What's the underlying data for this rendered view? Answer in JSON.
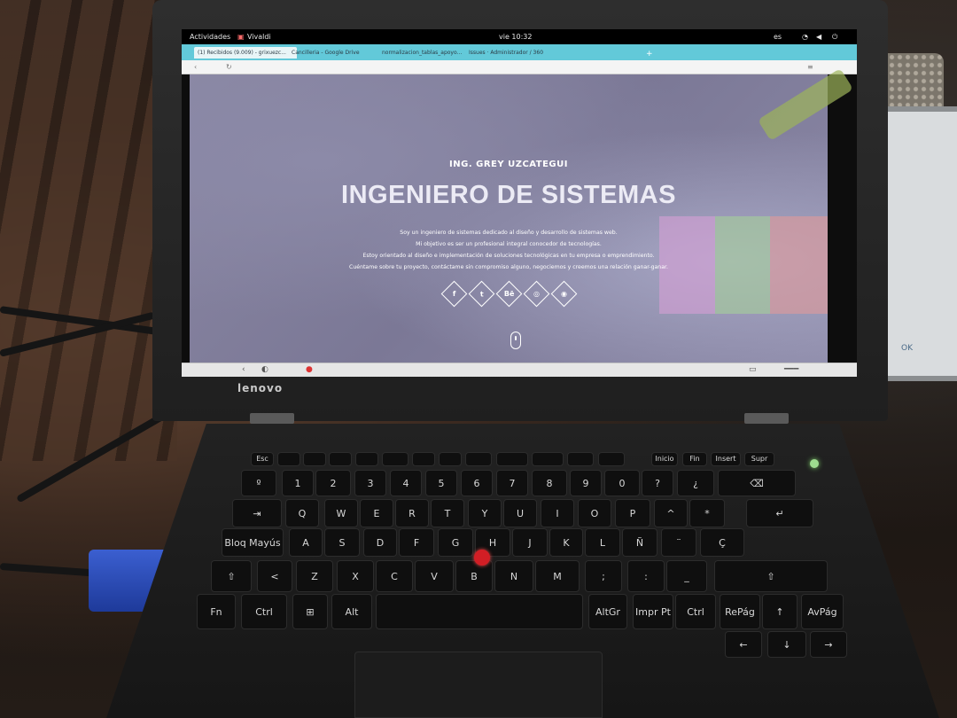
{
  "desktop": {
    "activities_label": "Actividades",
    "app_name": "Vivaldi",
    "clock": "vie 10:32",
    "keyboard_layout": "es"
  },
  "browser": {
    "tabs": [
      {
        "label": "(1) Recibidos (9.009) - grixuezc..."
      },
      {
        "label": "Cancilleria - Google Drive"
      },
      {
        "label": "normalizacion_tablas_apoyo..."
      },
      {
        "label": "Issues · Administrador / 360"
      }
    ]
  },
  "page": {
    "subtitle": "ING. GREY UZCATEGUI",
    "title": "INGENIERO DE SISTEMAS",
    "bio_lines": [
      "Soy un ingeniero de sistemas dedicado al diseño y desarrollo de sistemas web.",
      "Mi objetivo es ser un profesional integral conocedor de tecnologías.",
      "Estoy orientado al diseño e implementación de soluciones tecnológicas en tu empresa o emprendimiento.",
      "Cuéntame sobre tu proyecto, contáctame sin compromiso alguno, negociemos y creemos una relación ganar-ganar."
    ],
    "socials": [
      {
        "icon": "facebook-icon",
        "glyph": "f"
      },
      {
        "icon": "twitter-icon",
        "glyph": "t"
      },
      {
        "icon": "behance-icon",
        "glyph": "Bē"
      },
      {
        "icon": "instagram-icon",
        "glyph": "◎"
      },
      {
        "icon": "dribbble-icon",
        "glyph": "◉"
      }
    ]
  },
  "laptop": {
    "brand": "lenovo",
    "side_monitor_text": "OK"
  },
  "keyboard": {
    "rows": [
      [
        "Esc",
        "",
        "",
        "",
        "",
        "",
        "",
        "",
        "",
        "",
        "",
        "",
        "",
        "Inicio",
        "Fin",
        "Insert",
        "Supr"
      ],
      [
        "º",
        "1",
        "2",
        "3",
        "4",
        "5",
        "6",
        "7",
        "8",
        "9",
        "0",
        "?",
        "¿",
        "⌫"
      ],
      [
        "⇥",
        "Q",
        "W",
        "E",
        "R",
        "T",
        "Y",
        "U",
        "I",
        "O",
        "P",
        "^",
        "*",
        "↵"
      ],
      [
        "Bloq Mayús",
        "A",
        "S",
        "D",
        "F",
        "G",
        "H",
        "J",
        "K",
        "L",
        "Ñ",
        "¨",
        "Ç"
      ],
      [
        "⇧",
        "<",
        "Z",
        "X",
        "C",
        "V",
        "B",
        "N",
        "M",
        ";",
        ":",
        "_",
        "⇧"
      ],
      [
        "Fn",
        "Ctrl",
        "⊞",
        "Alt",
        "",
        "AltGr",
        "Impr Pt",
        "Ctrl",
        "RePág",
        "↑",
        "AvPág"
      ],
      [
        "←",
        "↓",
        "→"
      ]
    ]
  },
  "colors": {
    "vivaldi_bar": "#62c9d9",
    "trackpoint": "#d21e25",
    "power_led": "#9edc8f"
  }
}
